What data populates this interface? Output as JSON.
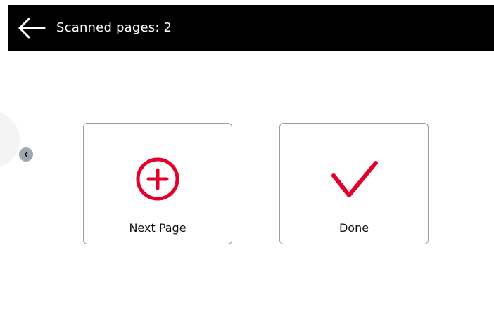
{
  "header": {
    "title": "Scanned pages: 2",
    "back_icon": "arrow-left-icon"
  },
  "side_panel": {
    "toggle_icon": "chevron-left-icon"
  },
  "actions": [
    {
      "label": "Next Page",
      "icon": "plus-circle-icon",
      "color": "#e4002b"
    },
    {
      "label": "Done",
      "icon": "checkmark-icon",
      "color": "#e4002b"
    }
  ],
  "colors": {
    "header_bg": "#000000",
    "accent": "#e4002b",
    "side_button": "#9ea6ae"
  }
}
